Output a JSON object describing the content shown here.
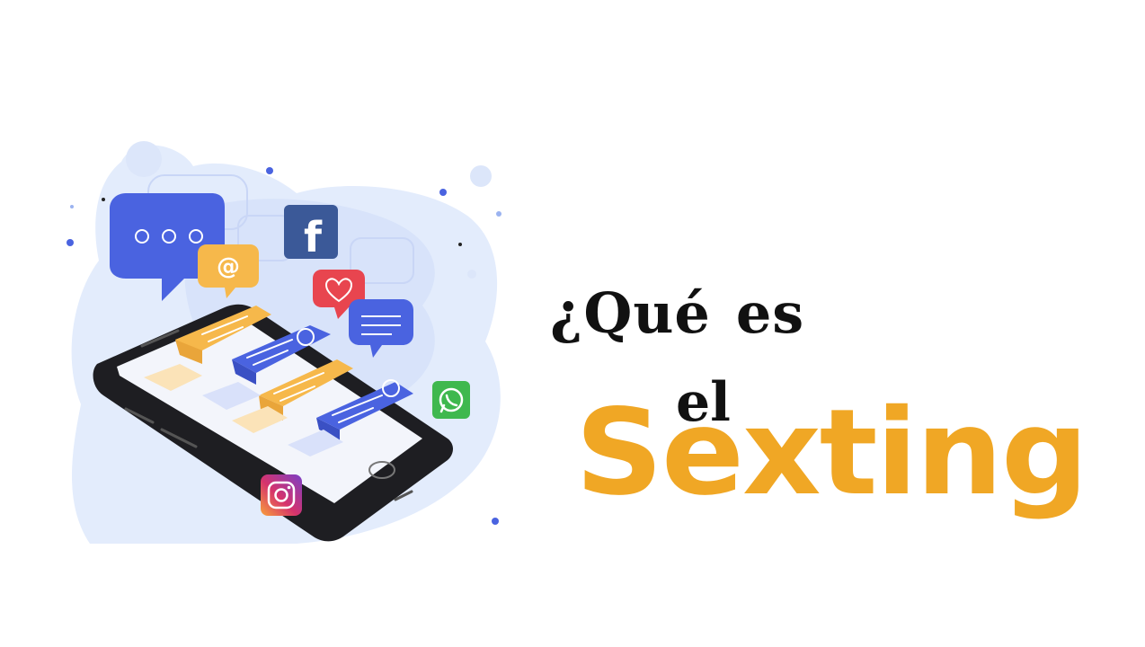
{
  "title": {
    "word1": "¿Qué",
    "word2": "es",
    "word3": "el",
    "highlight": "Sexting"
  },
  "illustration": {
    "icons": [
      "facebook-icon",
      "instagram-icon",
      "whatsapp-icon",
      "at-sign-icon",
      "heart-icon",
      "chat-bubble-icon"
    ],
    "colors": {
      "blob": "#DCE7FB",
      "phone": "#1E1E22",
      "blue_bubble": "#4A63E0",
      "yellow_bubble": "#F6B84B",
      "facebook": "#3B5998",
      "whatsapp": "#3FB84E",
      "heart": "#E8454F",
      "accent": "#F0A725"
    }
  }
}
